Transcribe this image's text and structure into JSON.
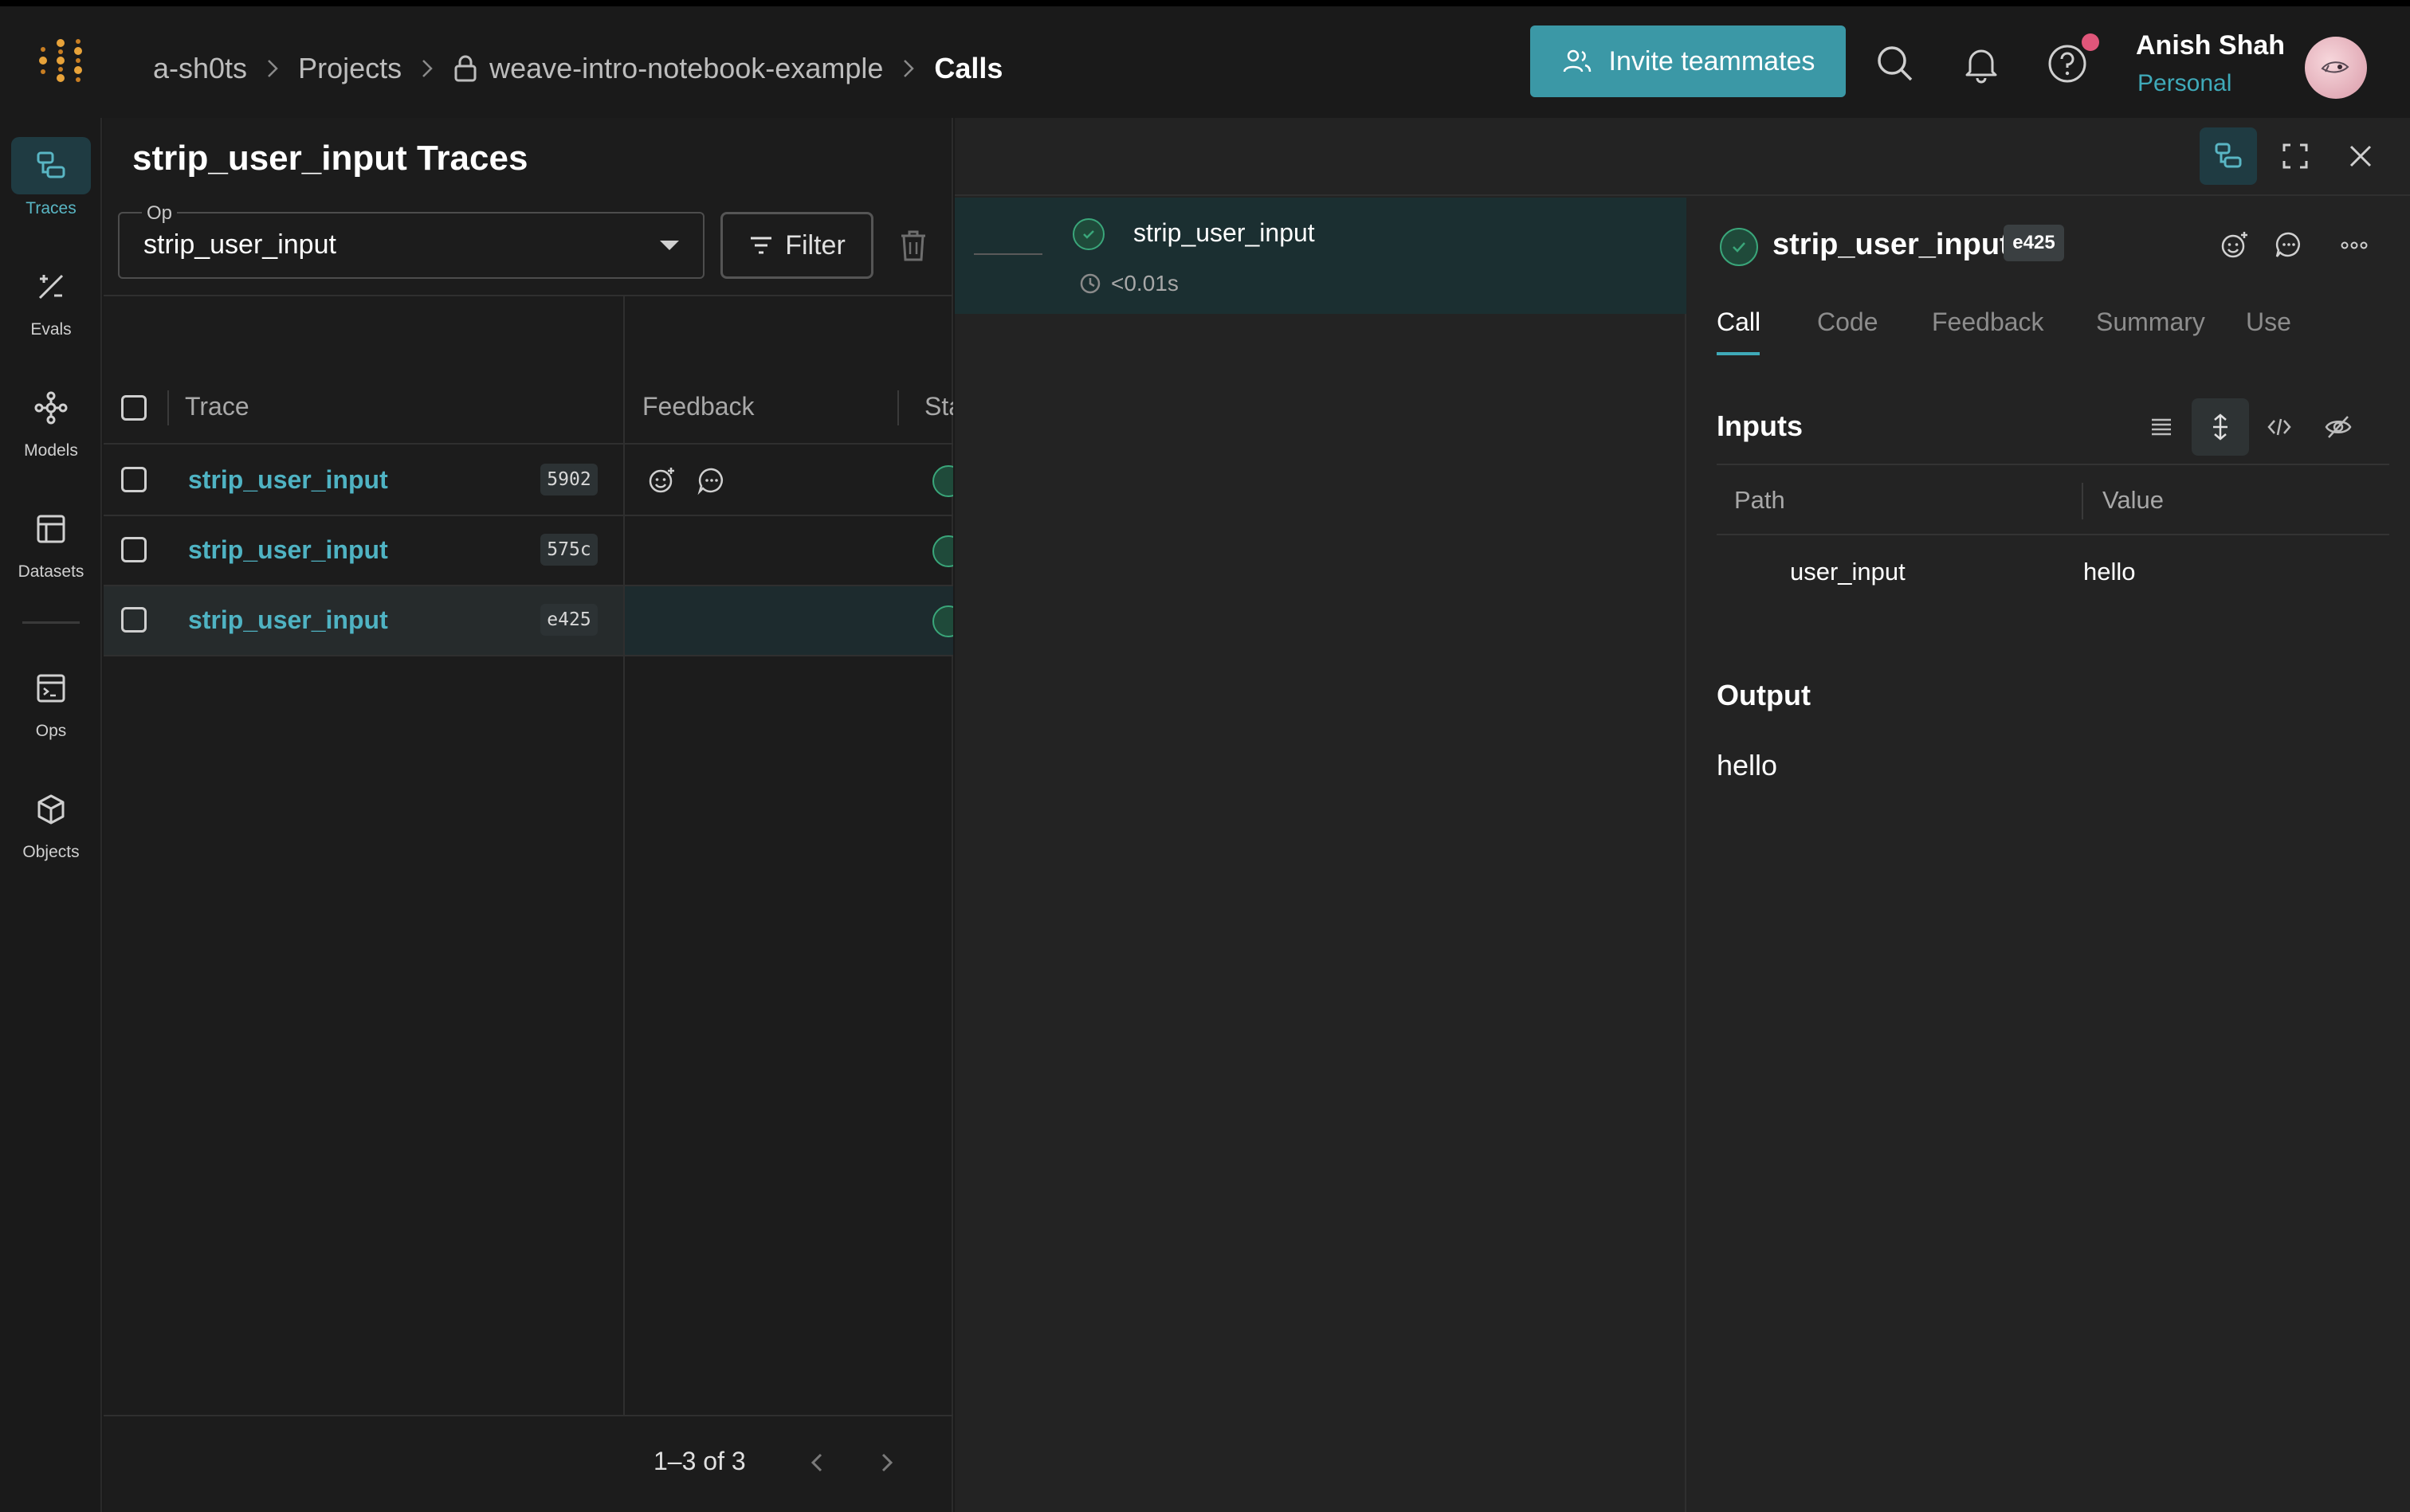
{
  "breadcrumb": {
    "entity": "a-sh0ts",
    "projects": "Projects",
    "project": "weave-intro-notebook-example",
    "current": "Calls"
  },
  "header": {
    "invite_label": "Invite teammates",
    "user_name": "Anish Shah",
    "user_subtitle": "Personal"
  },
  "nav": {
    "items": [
      {
        "label": "Traces",
        "icon": "traces-icon",
        "active": true
      },
      {
        "label": "Evals",
        "icon": "evals-icon"
      },
      {
        "label": "Models",
        "icon": "models-icon"
      },
      {
        "label": "Datasets",
        "icon": "datasets-icon"
      },
      {
        "label": "Ops",
        "icon": "ops-icon"
      },
      {
        "label": "Objects",
        "icon": "objects-icon"
      }
    ]
  },
  "traces": {
    "title": "strip_user_input Traces",
    "op_label": "Op",
    "op_value": "strip_user_input",
    "filter_label": "Filter",
    "columns": [
      "Trace",
      "Feedback",
      "Sta"
    ],
    "rows": [
      {
        "name": "strip_user_input",
        "id": "5902"
      },
      {
        "name": "strip_user_input",
        "id": "575c"
      },
      {
        "name": "strip_user_input",
        "id": "e425",
        "selected": true
      }
    ],
    "pagination": "1–3 of 3"
  },
  "tree": {
    "name": "strip_user_input",
    "duration": "<0.01s"
  },
  "call": {
    "title": "strip_user_input",
    "id": "e425",
    "tabs": [
      "Call",
      "Code",
      "Feedback",
      "Summary",
      "Use"
    ],
    "active_tab": "Call",
    "inputs_title": "Inputs",
    "path_header": "Path",
    "value_header": "Value",
    "input_path": "user_input",
    "input_value": "hello",
    "output_title": "Output",
    "output_value": "hello"
  },
  "colors": {
    "accent": "#3b98a6",
    "link": "#4fb3c3",
    "success": "#3aa67a",
    "notification": "#e0567a"
  }
}
